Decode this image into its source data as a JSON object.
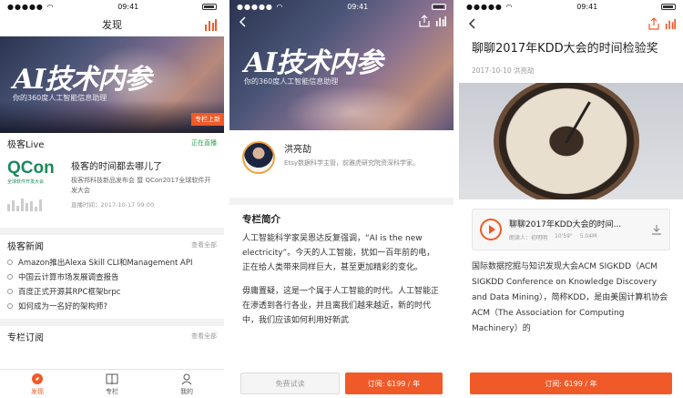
{
  "screen1": {
    "status_time": "09:41",
    "nav_title": "发现",
    "banner": {
      "title": "AI技术内参",
      "subtitle": "你的360度人工智能信息助理",
      "tag": "专栏上新"
    },
    "live": {
      "section_title": "极客Live",
      "status": "正在直播",
      "logo_text": "QCon",
      "logo_caption": "全球软件开发大会",
      "title": "极客的时间都去哪儿了",
      "desc": "极客邦科技新品发布会 暨 QCon2017全球软件开发大会",
      "time": "直播时间：2017-10-17 09:00"
    },
    "news": {
      "section_title": "极客新闻",
      "more": "查看全部",
      "items": [
        "Amazon推出Alexa Skill CLI和Management API",
        "中国云计算市场发展调查报告",
        "百度正式开源其RPC框架brpc",
        "如何成为一名好的架构师?"
      ]
    },
    "column": {
      "section_title": "专栏订阅",
      "more": "查看全部"
    },
    "tabs": [
      "发现",
      "专栏",
      "我的"
    ]
  },
  "screen2": {
    "status_time": "09:41",
    "banner": {
      "title": "AI技术内参",
      "subtitle": "你的360度人工智能信息助理"
    },
    "author": {
      "name": "洪亮劼",
      "desc": "Etsy数据科学主管，前雅虎研究院资深科学家。"
    },
    "intro_title": "专栏简介",
    "paragraphs": [
      "人工智能科学家吴恩达反复强调，“AI is the new electricity”。今天的人工智能，犹如一百年前的电，正在给人类带来同样巨大，甚至更加精彩的变化。",
      "毋庸置疑，这是一个属于人工智能的时代。人工智能正在渗透到各行各业，并且离我们越来越近，新的时代中，我们应该如何利用好新武"
    ],
    "btn_trial": "免费试读",
    "btn_sub": "订阅: ₲199 / 年"
  },
  "screen3": {
    "status_time": "09:41",
    "title": "聊聊2017年KDD大会的时间检验奖",
    "meta": "2017-10-10  洪亮劼",
    "audio": {
      "title": "聊聊2017年KDD大会的时间...",
      "reader": "朗读人：初明明",
      "duration": "10'59\"",
      "size": "5.04M"
    },
    "p1": "国际数据挖掘与知识发现大会ACM SIGKDD（ACM SIGKDD Conference on Knowledge Discovery and Data Mining），简称KDD，是由美国计算机协会ACM（The Association for Computing Machinery）的",
    "btn_sub": "订阅: ₲199 / 年"
  },
  "colors": {
    "accent": "#f05a28",
    "live_green": "#2aa54b"
  }
}
